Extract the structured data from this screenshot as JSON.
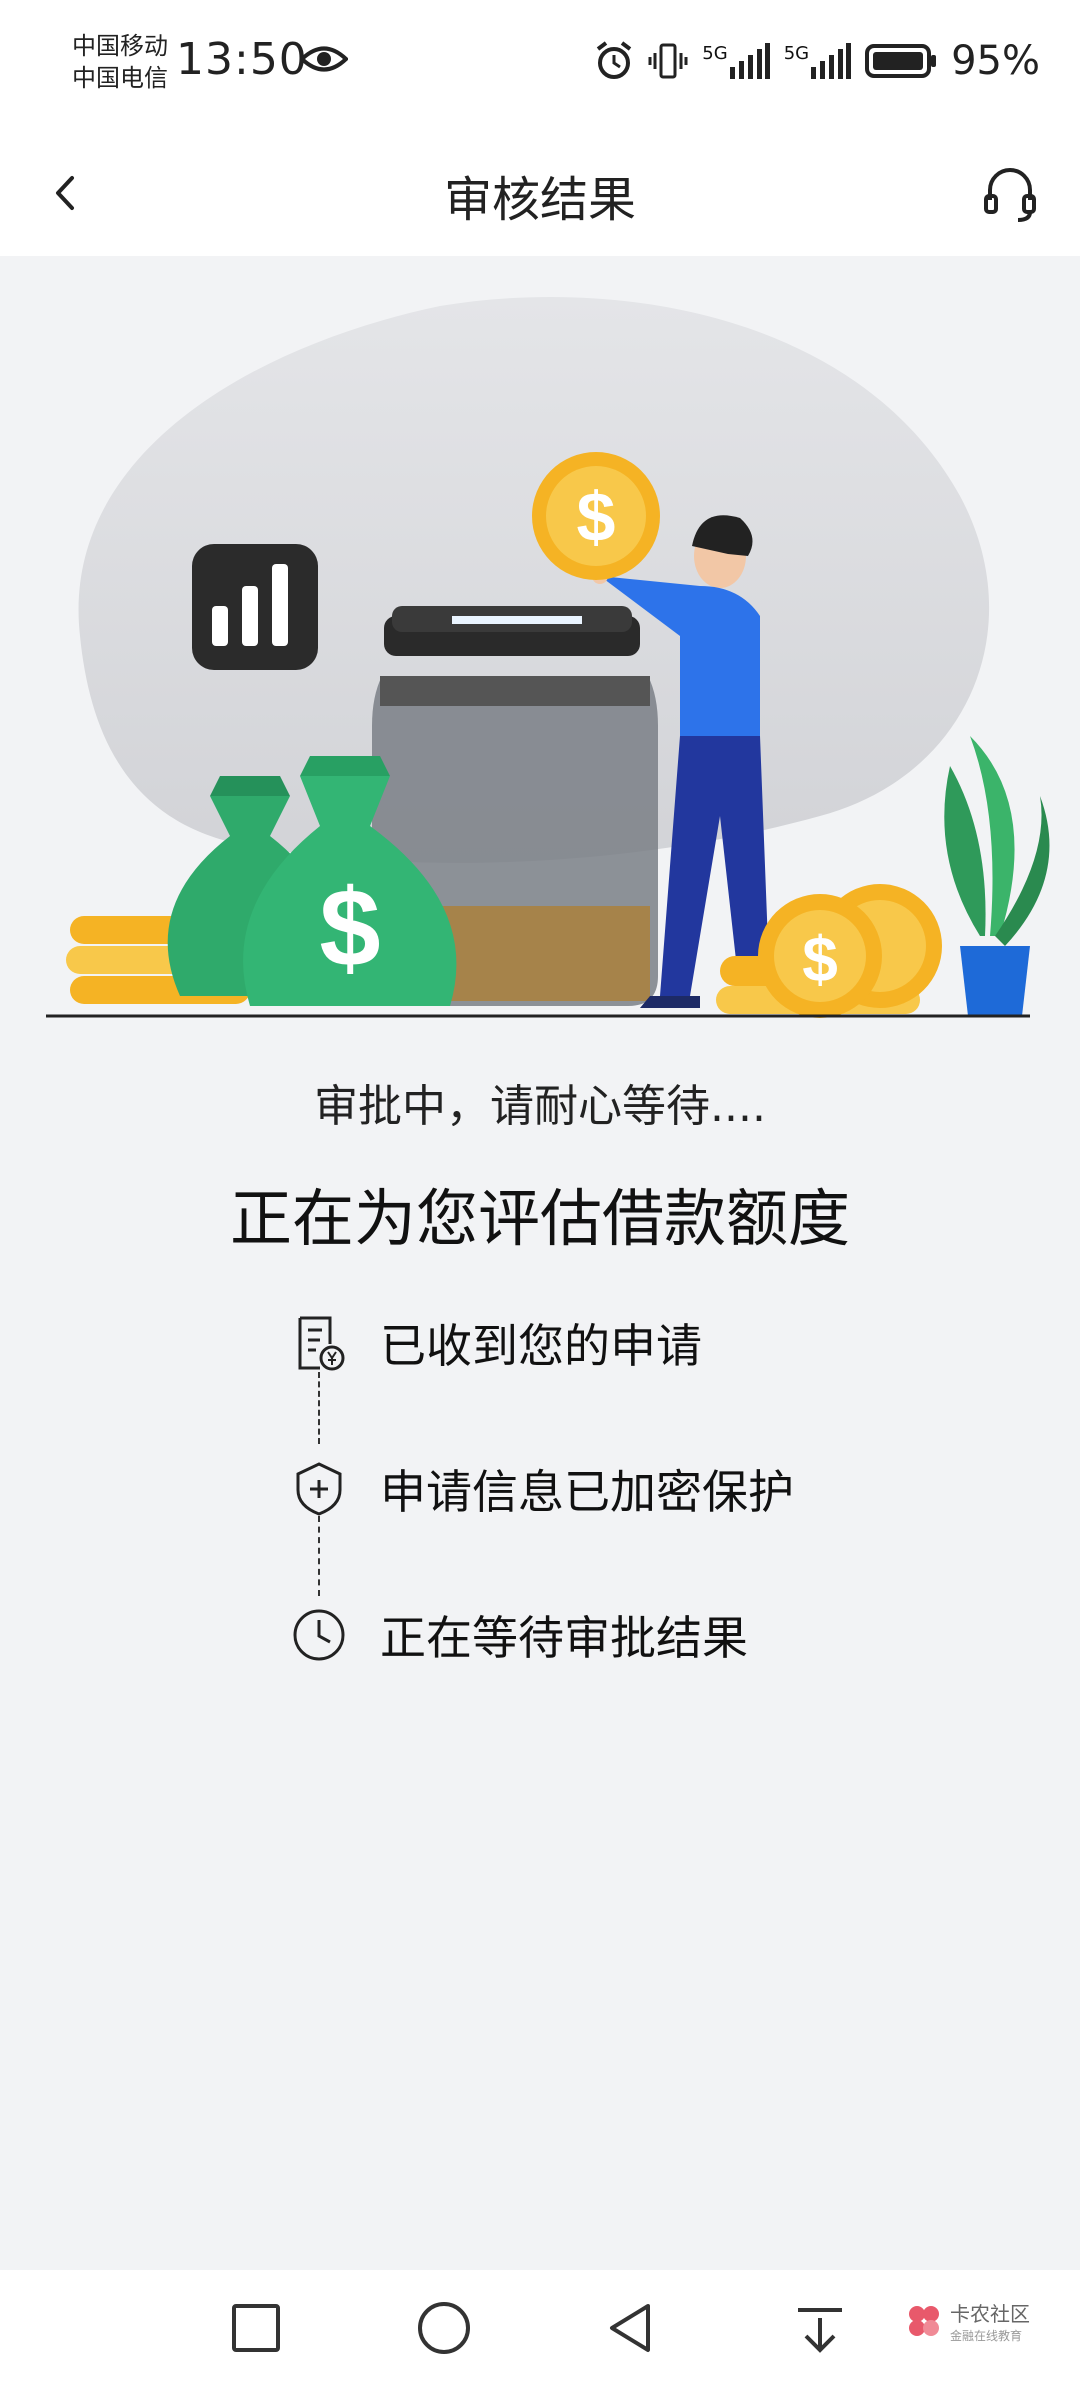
{
  "status_bar": {
    "carrier_1": "中国移动",
    "carrier_2": "中国电信",
    "time": "13:50",
    "net_1": "5G",
    "net_2": "5G",
    "battery": "95%"
  },
  "header": {
    "title": "审核结果"
  },
  "content": {
    "subtitle": "审批中，请耐心等待....",
    "headline": "正在为您评估借款额度",
    "steps": [
      {
        "label": "已收到您的申请",
        "icon": "document-yuan-icon"
      },
      {
        "label": "申请信息已加密保护",
        "icon": "shield-plus-icon"
      },
      {
        "label": "正在等待审批结果",
        "icon": "clock-icon"
      }
    ]
  },
  "watermark": {
    "main": "卡农社区",
    "sub": "金融在线教育"
  },
  "colors": {
    "background": "#f2f3f5",
    "green": "#2faa6b",
    "gold": "#f5b324",
    "blue": "#2b6de8"
  }
}
